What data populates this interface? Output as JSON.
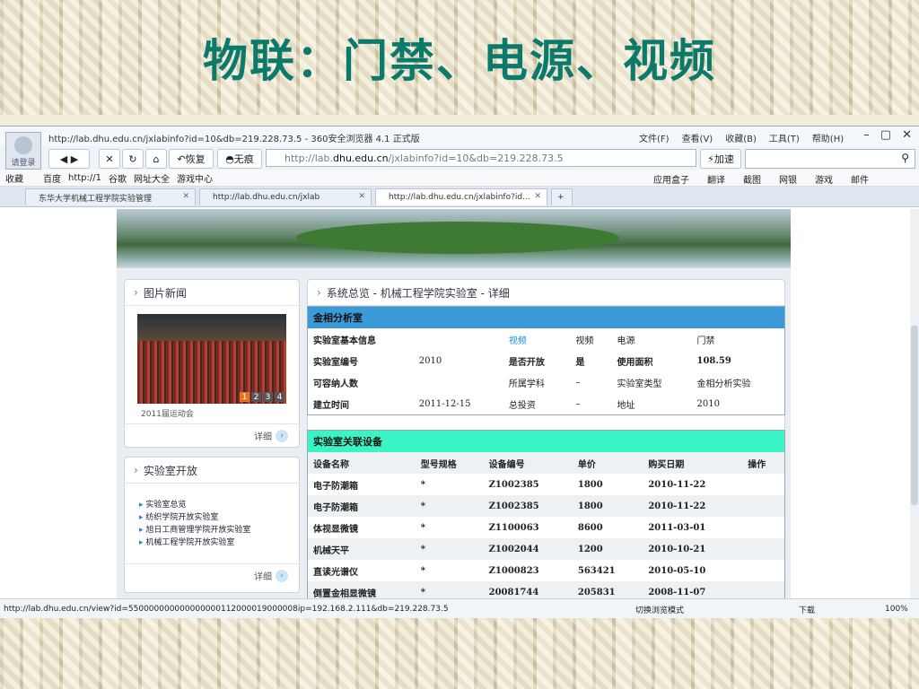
{
  "slide": {
    "title": "物联：门禁、电源、视频"
  },
  "browser": {
    "title": "http://lab.dhu.edu.cn/jxlabinfo?id=10&db=219.228.73.5 - 360安全浏览器 4.1 正式版",
    "avatar_label": "请登录",
    "menu": [
      "文件(F)",
      "查看(V)",
      "收藏(B)",
      "工具(T)",
      "帮助(H)"
    ],
    "nav": {
      "restore": "恢复",
      "notrace": "无痕",
      "speedup": "加速"
    },
    "address": {
      "prefix": "http://lab.",
      "domain": "dhu.edu.cn",
      "suffix": "/jxlabinfo?id=10&db=219.228.73.5"
    },
    "favorites": [
      "收藏",
      "百度",
      "http://1",
      "谷歌",
      "网址大全",
      "游戏中心"
    ],
    "toolbar_right": [
      "应用盒子",
      "翻译",
      "截图",
      "网银",
      "游戏",
      "邮件"
    ],
    "tabs": [
      {
        "label": "东华大学机械工程学院实验管理"
      },
      {
        "label": "http://lab.dhu.edu.cn/jxlab"
      },
      {
        "label": "http://lab.dhu.edu.cn/jxlabinfo?id..."
      }
    ],
    "status_url": "http://lab.dhu.edu.cn/view?id=550000000000000000112000019000008ip=192.168.2.111&db=219.228.73.5",
    "status_right": {
      "mode": "切换浏览模式",
      "download": "下载",
      "zoom": "100%"
    }
  },
  "left": {
    "news": {
      "title": "图片新闻",
      "caption": "2011届运动会",
      "pages": [
        "1",
        "2",
        "3",
        "4"
      ],
      "more": "详细"
    },
    "open": {
      "title": "实验室开放",
      "links": [
        "实验室总览",
        "纺织学院开放实验室",
        "旭日工商管理学院开放实验室",
        "机械工程学院开放实验室"
      ],
      "more": "详细"
    }
  },
  "main": {
    "breadcrumb": "系统总览 - 机械工程学院实验室 - 详细",
    "lab_name": "金相分析室",
    "info_rows": [
      [
        "实验室基本信息",
        "",
        "视频",
        "视频",
        "电源",
        "门禁"
      ],
      [
        "实验室编号",
        "2010",
        "是否开放",
        "是",
        "使用面积",
        "108.59"
      ],
      [
        "可容纳人数",
        "",
        "所属学科",
        "–",
        "实验室类型",
        "金相分析实验"
      ],
      [
        "建立时间",
        "2011-12-15",
        "总投资",
        "–",
        "地址",
        "2010"
      ]
    ],
    "equipment_title": "实验室关联设备",
    "equipment_headers": [
      "设备名称",
      "型号规格",
      "设备编号",
      "单价",
      "购买日期",
      "操作"
    ],
    "equipment_rows": [
      [
        "电子防潮箱",
        "*",
        "Z1002385",
        "1800",
        "2010-11-22",
        ""
      ],
      [
        "电子防潮箱",
        "*",
        "Z1002385",
        "1800",
        "2010-11-22",
        ""
      ],
      [
        "体视显微镜",
        "*",
        "Z1100063",
        "8600",
        "2011-03-01",
        ""
      ],
      [
        "机械天平",
        "*",
        "Z1002044",
        "1200",
        "2010-10-21",
        ""
      ],
      [
        "直读光谱仪",
        "*",
        "Z1000823",
        "563421",
        "2010-05-10",
        ""
      ],
      [
        "倒置金相显微镜",
        "*",
        "20081744",
        "205831",
        "2008-11-07",
        ""
      ]
    ]
  },
  "colors": {
    "title_teal": "#0b7a6b",
    "lab_header_blue": "#3b9ad8",
    "equip_header_mint": "#39f5c5",
    "link_blue": "#1a8fdc"
  }
}
